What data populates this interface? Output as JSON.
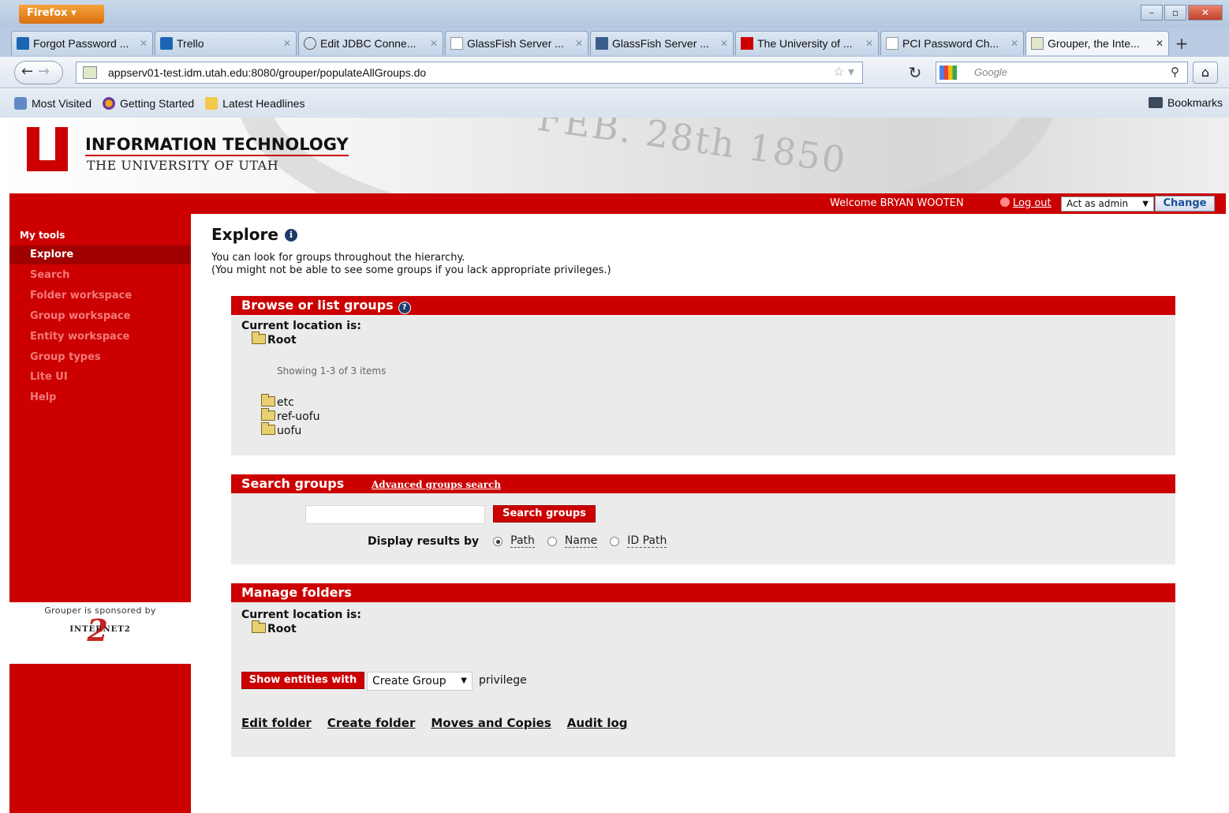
{
  "browser": {
    "menu_label": "Firefox",
    "tabs": [
      {
        "label": "Forgot Password ...",
        "icon": "trello-icon"
      },
      {
        "label": "Trello",
        "icon": "trello-icon"
      },
      {
        "label": "Edit JDBC Conne...",
        "icon": "loading-icon"
      },
      {
        "label": "GlassFish Server ...",
        "icon": "page-icon"
      },
      {
        "label": "GlassFish Server ...",
        "icon": "sun-icon"
      },
      {
        "label": "The University of ...",
        "icon": "uofu-icon"
      },
      {
        "label": "PCI Password Ch...",
        "icon": "page-icon"
      },
      {
        "label": "Grouper, the Inte...",
        "icon": "grouper-icon",
        "active": true
      }
    ],
    "url": "appserv01-test.idm.utah.edu:8080/grouper/populateAllGroups.do",
    "search_placeholder": "Google",
    "bookmarks": [
      "Most Visited",
      "Getting Started",
      "Latest Headlines"
    ],
    "bookmarks_menu": "Bookmarks"
  },
  "header": {
    "org_title": "INFORMATION TECHNOLOGY",
    "org_subtitle": "THE UNIVERSITY OF UTAH",
    "seal_text": "FEB. 28th 1850",
    "welcome": "Welcome BRYAN WOOTEN",
    "logout": "Log out",
    "act_as": "Act as admin",
    "change": "Change"
  },
  "sidebar": {
    "heading": "My tools",
    "items": [
      "Explore",
      "Search",
      "Folder workspace",
      "Group workspace",
      "Entity workspace",
      "Group types",
      "Lite UI",
      "Help"
    ],
    "active_index": 0,
    "sponsor_text": "Grouper is sponsored by",
    "sponsor_logo": "INTERNET2"
  },
  "main": {
    "title": "Explore",
    "intro_line1": "You can look for groups throughout the hierarchy.",
    "intro_line2": "(You might not be able to see some groups if you lack appropriate privileges.)",
    "browse": {
      "heading": "Browse or list groups",
      "location_label": "Current location is:",
      "location": "Root",
      "showing": "Showing 1-3 of 3 items",
      "folders": [
        "etc",
        "ref-uofu",
        "uofu"
      ]
    },
    "search": {
      "heading": "Search groups",
      "advanced_link": "Advanced groups search",
      "input_value": "",
      "button": "Search groups",
      "display_label": "Display results by",
      "options": [
        "Path",
        "Name",
        "ID Path"
      ],
      "selected": "Path"
    },
    "manage": {
      "heading": "Manage folders",
      "location_label": "Current location is:",
      "location": "Root",
      "show_button": "Show entities with",
      "privilege_select": "Create Group",
      "privilege_word": "privilege",
      "actions": [
        "Edit folder",
        "Create folder",
        "Moves and Copies",
        "Audit log"
      ]
    }
  },
  "colors": {
    "brand_red": "#cc0000",
    "panel_bg": "#ebebeb"
  }
}
